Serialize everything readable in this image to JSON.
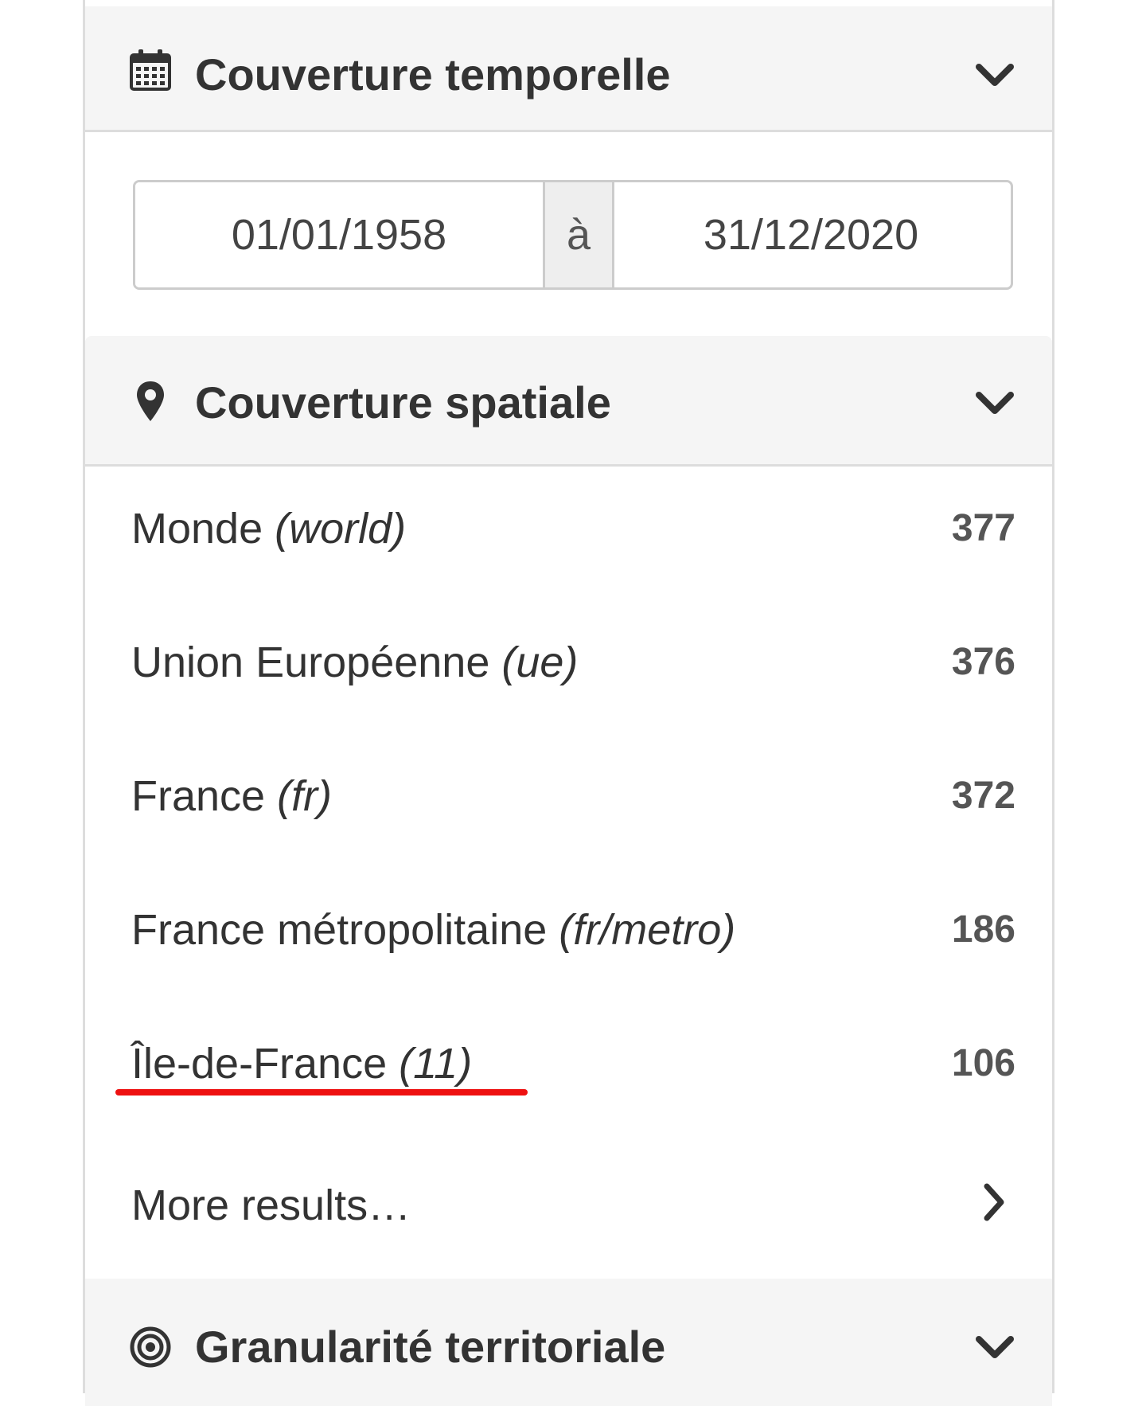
{
  "sections": {
    "temporal": {
      "title": "Couverture temporelle",
      "icon": "calendar-icon",
      "date_from": "01/01/1958",
      "separator": "à",
      "date_to": "31/12/2020"
    },
    "spatial": {
      "title": "Couverture spatiale",
      "icon": "map-marker-icon",
      "items": [
        {
          "label": "Monde",
          "code": "(world)",
          "count": "377"
        },
        {
          "label": "Union Européenne",
          "code": "(ue)",
          "count": "376"
        },
        {
          "label": "France",
          "code": "(fr)",
          "count": "372"
        },
        {
          "label": "France métropolitaine",
          "code": "(fr/metro)",
          "count": "186"
        },
        {
          "label": "Île-de-France",
          "code": "(11)",
          "count": "106"
        }
      ],
      "more_results": "More results…"
    },
    "granularity": {
      "title": "Granularité territoriale",
      "icon": "target-icon"
    }
  },
  "colors": {
    "header_bg": "#f5f5f5",
    "text": "#333333",
    "annotation_underline": "#ee1111"
  }
}
